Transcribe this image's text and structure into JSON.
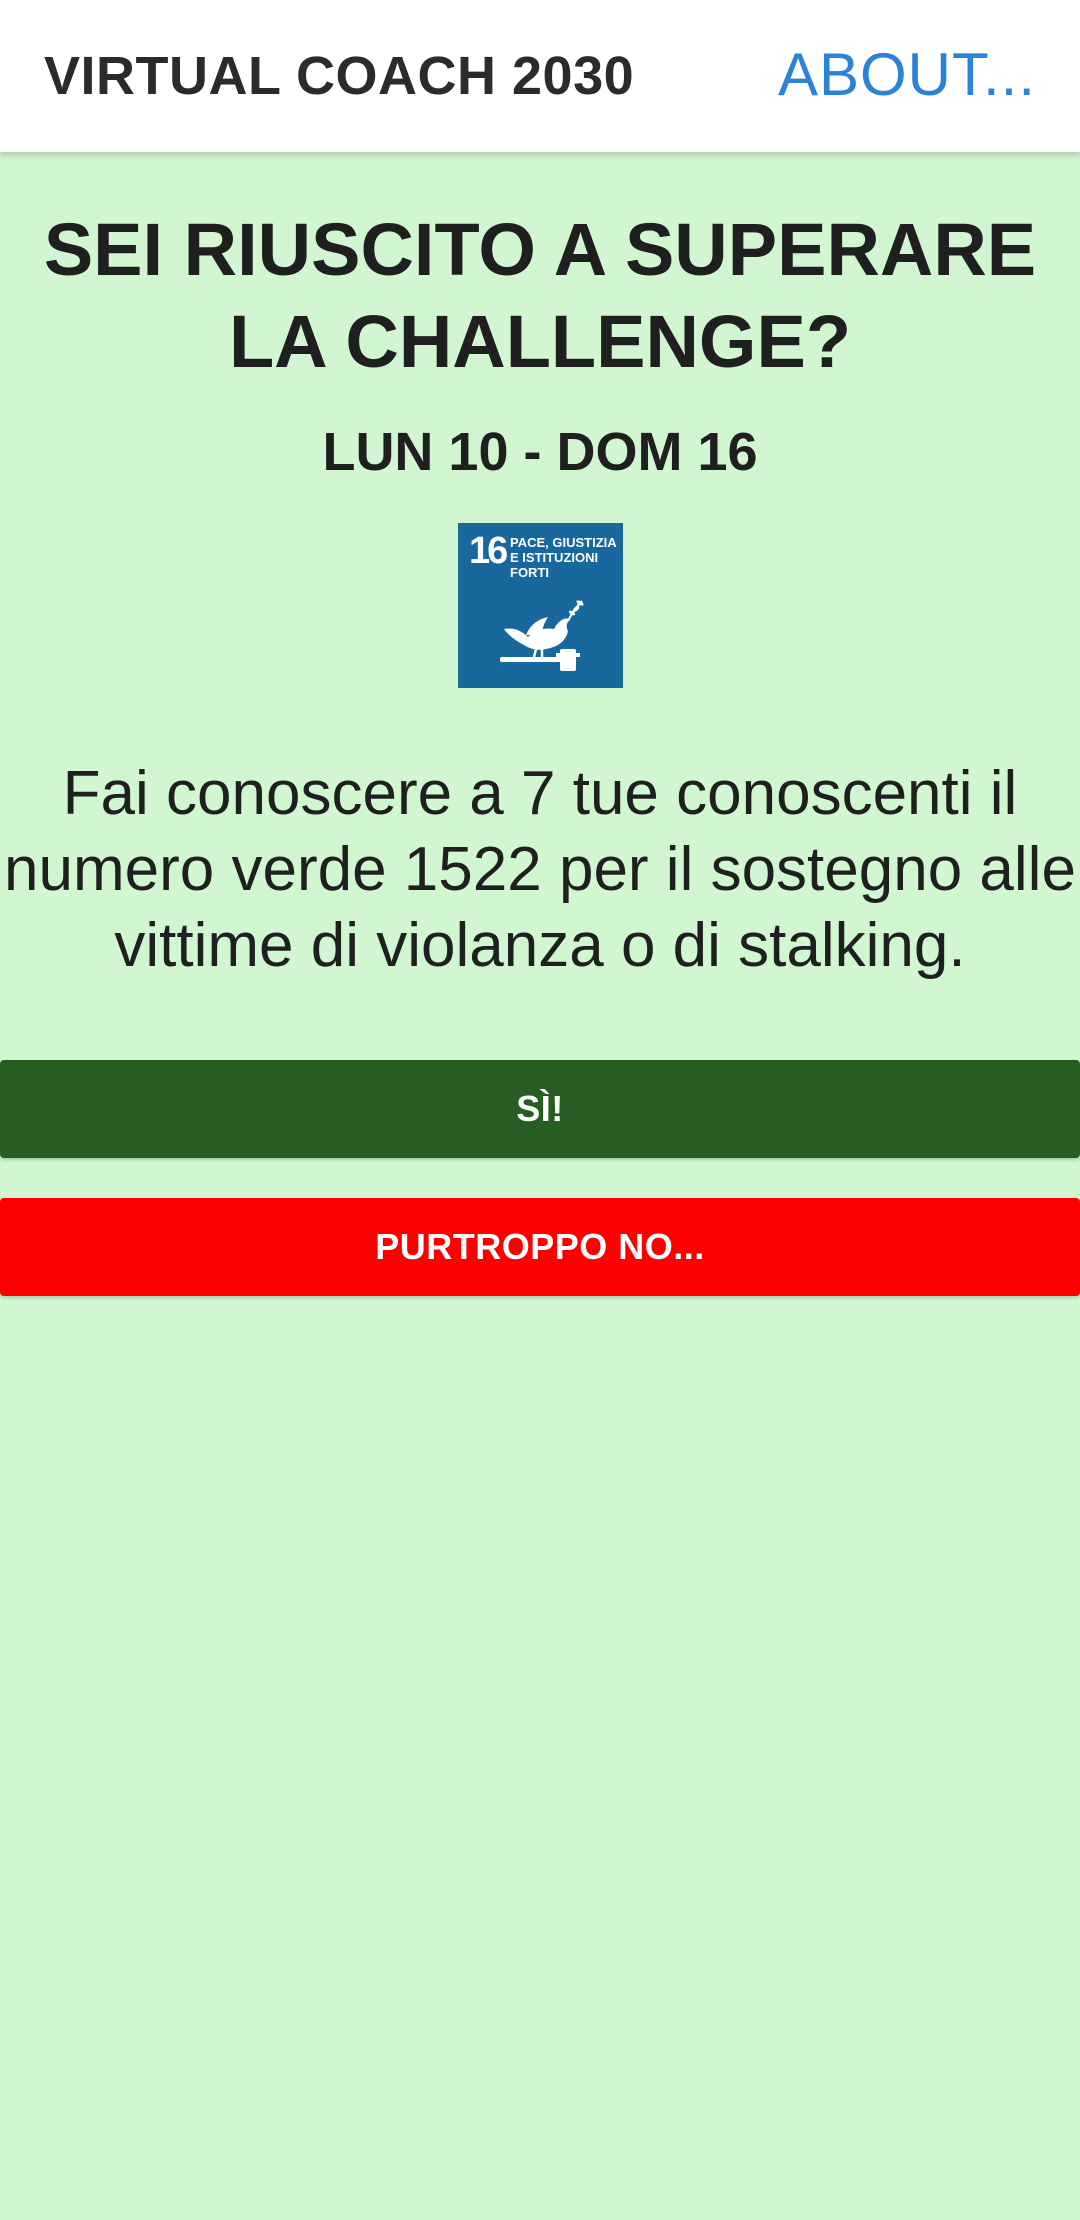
{
  "header": {
    "title": "VIRTUAL COACH 2030",
    "about_label": "ABOUT..."
  },
  "challenge": {
    "question": "SEI RIUSCITO A SUPERARE LA CHALLENGE?",
    "date_range": "LUN 10 - DOM 16",
    "sdg": {
      "number": "16",
      "label": "PACE, GIUSTIZIA\nE ISTITUZIONI\nFORTI",
      "color": "#19689d",
      "icon": "dove-gavel-icon"
    },
    "description": "Fai conoscere a 7 tue conoscenti il numero verde 1522 per il sostegno alle vittime di violanza o di stalking."
  },
  "actions": {
    "yes_label": "SÌ!",
    "yes_color": "#275d22",
    "no_label": "PURTROPPO NO...",
    "no_color": "#ff0000"
  },
  "colors": {
    "background": "#d1f6d1",
    "accent": "#2b82d9"
  }
}
